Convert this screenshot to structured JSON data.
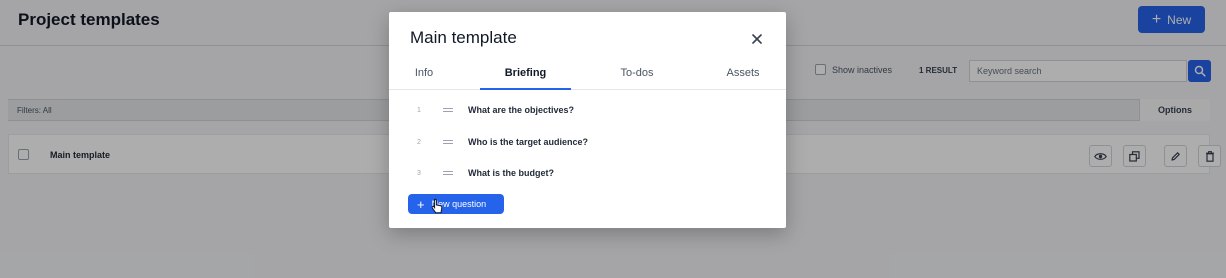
{
  "page": {
    "title": "Project templates",
    "new_button_label": "New"
  },
  "toolbar": {
    "show_inactives_label": "Show inactives",
    "result_count": "1 RESULT",
    "search_placeholder": "Keyword search"
  },
  "filter_bar": {
    "filters_label": "Filters: All",
    "options_label": "Options"
  },
  "table": {
    "rows": [
      {
        "label": "Main template"
      }
    ]
  },
  "modal": {
    "title": "Main template",
    "tabs": [
      {
        "label": "Info",
        "active": false
      },
      {
        "label": "Briefing",
        "active": true
      },
      {
        "label": "To-dos",
        "active": false
      },
      {
        "label": "Assets",
        "active": false
      }
    ],
    "questions": [
      {
        "number": "1",
        "text": "What are the objectives?"
      },
      {
        "number": "2",
        "text": "Who is the target audience?"
      },
      {
        "number": "3",
        "text": "What is the budget?"
      }
    ],
    "new_question_label": "New question"
  },
  "colors": {
    "accent": "#2563eb",
    "overlay": "rgba(0,0,0,0.32)"
  },
  "icons": [
    "plus-icon",
    "search-icon",
    "eye-icon",
    "duplicate-icon",
    "pencil-icon",
    "trash-icon",
    "close-icon",
    "drag-handle-icon",
    "pointer-cursor-icon"
  ]
}
